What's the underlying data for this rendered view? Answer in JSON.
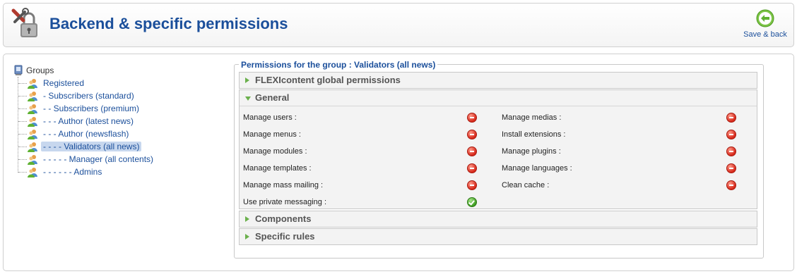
{
  "header": {
    "title": "Backend & specific permissions",
    "header_icon": "tools-lock-icon",
    "save_back_label": "Save & back",
    "save_back_icon": "back-arrow-icon"
  },
  "groups": {
    "root_label": "Groups",
    "items": [
      {
        "label": "Registered",
        "selected": false
      },
      {
        "label": "- Subscribers (standard)",
        "selected": false
      },
      {
        "label": "- - Subscribers (premium)",
        "selected": false
      },
      {
        "label": "- - - Author (latest news)",
        "selected": false
      },
      {
        "label": "- - - Author (newsflash)",
        "selected": false
      },
      {
        "label": "- - - - Validators (all news)",
        "selected": true
      },
      {
        "label": "- - - - - Manager (all contents)",
        "selected": false
      },
      {
        "label": "- - - - - - Admins",
        "selected": false
      }
    ]
  },
  "permissions": {
    "legend": "Permissions for the group : Validators (all news)",
    "panels": [
      {
        "title": "FLEXIcontent global permissions",
        "expanded": false
      },
      {
        "title": "General",
        "expanded": true
      },
      {
        "title": "Components",
        "expanded": false
      },
      {
        "title": "Specific rules",
        "expanded": false
      }
    ],
    "general": {
      "left": [
        {
          "label": "Manage users :",
          "status": "deny"
        },
        {
          "label": "Manage menus :",
          "status": "deny"
        },
        {
          "label": "Manage modules :",
          "status": "deny"
        },
        {
          "label": "Manage templates :",
          "status": "deny"
        },
        {
          "label": "Manage mass mailing :",
          "status": "deny"
        },
        {
          "label": "Use private messaging :",
          "status": "allow"
        }
      ],
      "right": [
        {
          "label": "Manage medias :",
          "status": "deny"
        },
        {
          "label": "Install extensions :",
          "status": "deny"
        },
        {
          "label": "Manage plugins :",
          "status": "deny"
        },
        {
          "label": "Manage languages :",
          "status": "deny"
        },
        {
          "label": "Clean cache :",
          "status": "deny"
        }
      ]
    }
  },
  "colors": {
    "title_blue": "#1b4f9b",
    "deny_red": "#d7281a",
    "allow_green": "#3f9e22",
    "arrow_green": "#6ab04c"
  }
}
